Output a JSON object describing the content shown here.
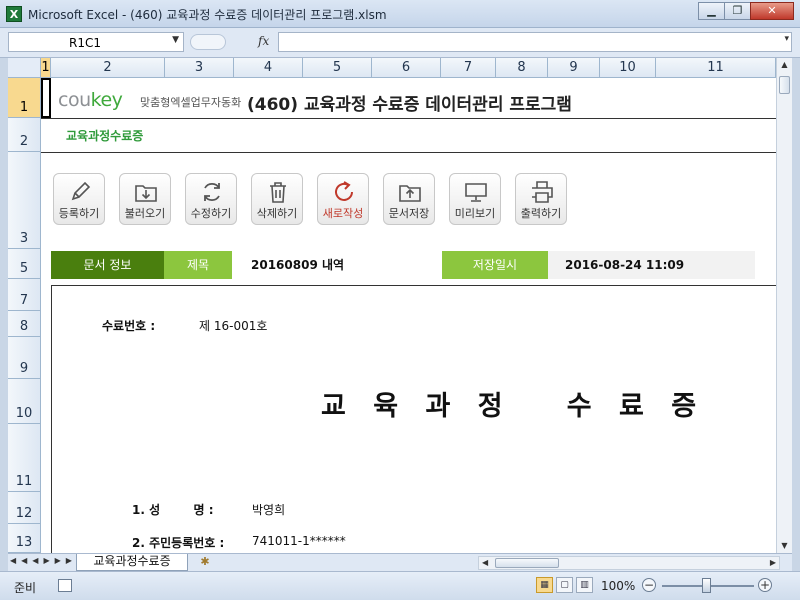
{
  "window": {
    "title": "Microsoft Excel - (460) 교육과정 수료증 데이터관리 프로그램.xlsm",
    "app_icon": "X",
    "controls": [
      "minimize-icon",
      "restore-icon",
      "close-icon"
    ]
  },
  "formula_bar": {
    "name_box": "R1C1",
    "fx_label": "fx",
    "formula": ""
  },
  "columns": [
    "1",
    "2",
    "3",
    "4",
    "5",
    "6",
    "7",
    "8",
    "9",
    "10",
    "11"
  ],
  "rows": [
    "1",
    "2",
    "3",
    "5",
    "7",
    "8",
    "9",
    "10",
    "11",
    "12",
    "13"
  ],
  "selected_cell": {
    "row": "1",
    "column": "1"
  },
  "header": {
    "logo_main": "cou",
    "logo_accent": "key",
    "logo_tagline": "맞춤형엑셀업무자동화",
    "program_title": "(460) 교육과정 수료증 데이터관리 프로그램",
    "sheet_subtitle": "교육과정수료증"
  },
  "toolbar": [
    {
      "label": "등록하기",
      "icon": "pencil-icon"
    },
    {
      "label": "불러오기",
      "icon": "download-folder-icon"
    },
    {
      "label": "수정하기",
      "icon": "refresh-icon"
    },
    {
      "label": "삭제하기",
      "icon": "trash-icon"
    },
    {
      "label": "새로작성",
      "icon": "new-refresh-icon"
    },
    {
      "label": "문서저장",
      "icon": "upload-folder-icon"
    },
    {
      "label": "미리보기",
      "icon": "monitor-icon"
    },
    {
      "label": "출력하기",
      "icon": "printer-icon"
    }
  ],
  "doc_info": {
    "section_label": "문서 정보",
    "title_label": "제목",
    "title_value": "20160809 내역",
    "saved_label": "저장일시",
    "saved_value": "2016-08-24 11:09"
  },
  "certificate": {
    "number_label": "수료번호 :",
    "number_value": "제 16-001호",
    "title": "교 육 과 정   수 료 증",
    "fields": [
      {
        "label": "1. 성        명 :",
        "value": "박영희"
      },
      {
        "label": "2. 주민등록번호 :",
        "value": "741011-1******"
      }
    ]
  },
  "sheet_tabs": [
    "교육과정수료증"
  ],
  "statusbar": {
    "mode": "준비",
    "zoom": "100%"
  },
  "colors": {
    "doc_label_bg": "#4a7f0e",
    "accent_green": "#8cc63e",
    "subtitle_green": "#2f9a3a",
    "selection": "#f8d98f"
  }
}
